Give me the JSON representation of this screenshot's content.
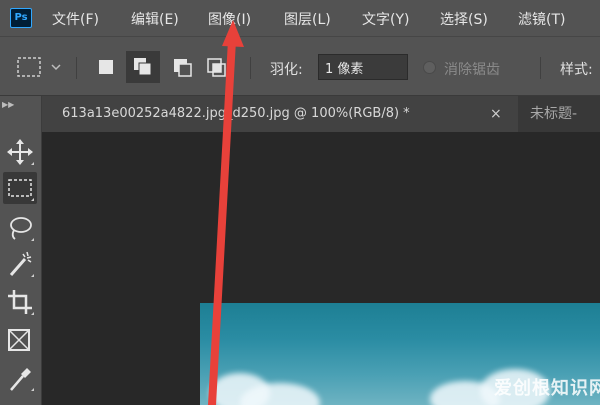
{
  "app": {
    "logo_text": "Ps"
  },
  "menu": {
    "items": [
      {
        "label": "文件(F)"
      },
      {
        "label": "编辑(E)"
      },
      {
        "label": "图像(I)"
      },
      {
        "label": "图层(L)"
      },
      {
        "label": "文字(Y)"
      },
      {
        "label": "选择(S)"
      },
      {
        "label": "滤镜(T)"
      }
    ]
  },
  "options": {
    "feather_label": "羽化:",
    "feather_value": "1 像素",
    "antialias_label": "消除锯齿",
    "style_label": "样式:"
  },
  "tabs": {
    "active_label": "613a13e00252a4822.jpg_d250.jpg @ 100%(RGB/8) *",
    "close_glyph": "×",
    "inactive_label": "未标题-"
  },
  "watermark": {
    "text": "爱创根知识网"
  },
  "colors": {
    "accent_ps": "#31a8ff",
    "arrow": "#e8413a",
    "panel": "#535353",
    "canvas_bg": "#282828"
  }
}
